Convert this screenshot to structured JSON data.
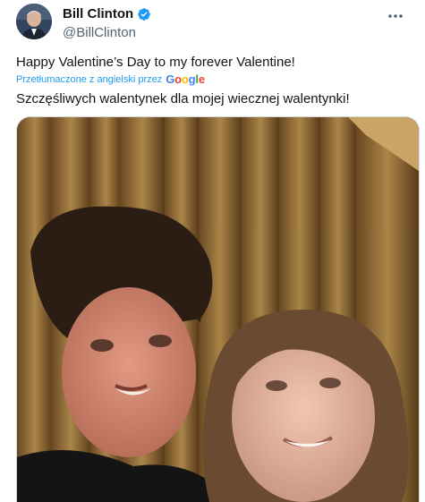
{
  "author": {
    "display_name": "Bill Clinton",
    "handle": "@BillClinton",
    "verified": true
  },
  "tweet": {
    "text": "Happy Valentine’s Day to my forever Valentine!",
    "translation_label": "Przetłumaczone z angielski przez",
    "translation_provider": "Google",
    "translated_text": "Szczęśliwych walentynek dla mojej wiecznej walentynki!"
  },
  "icons": {
    "verified": "verified-badge-icon",
    "more": "more-options-icon"
  },
  "colors": {
    "accent": "#1d9bf0",
    "secondary_text": "#536471"
  }
}
